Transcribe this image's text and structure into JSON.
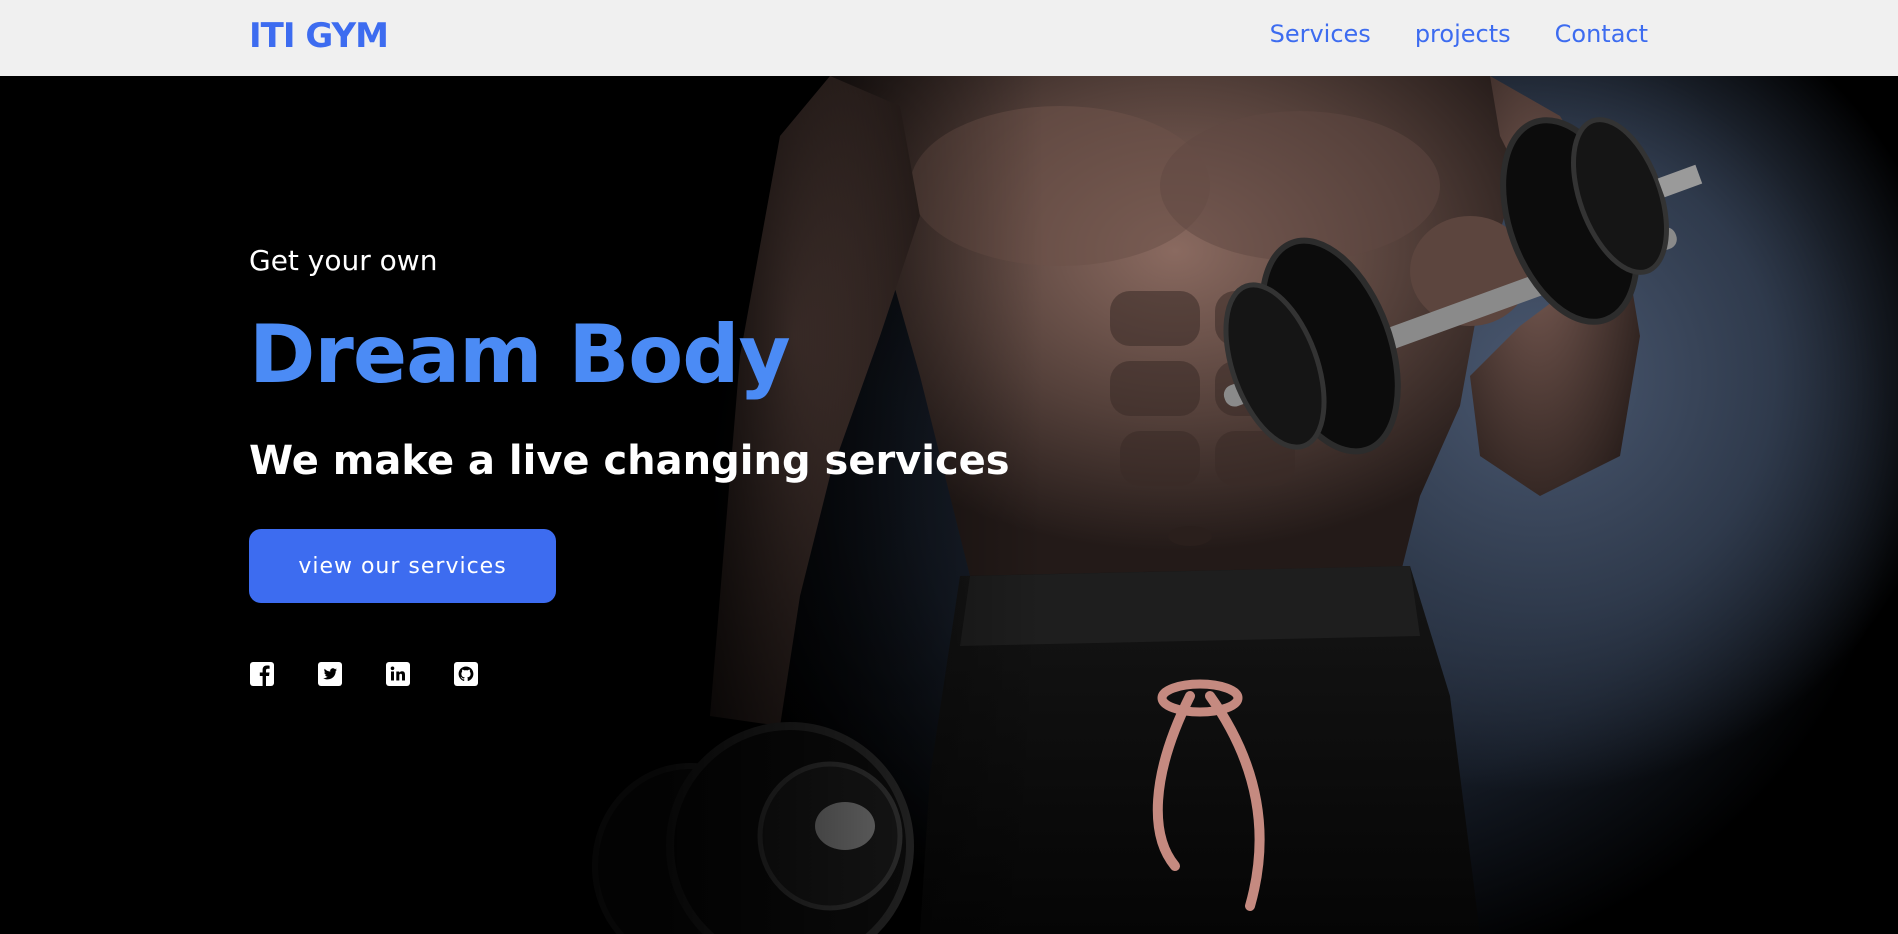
{
  "brand": "ITI GYM",
  "nav": {
    "items": [
      {
        "label": "Services"
      },
      {
        "label": "projects"
      },
      {
        "label": "Contact"
      }
    ]
  },
  "hero": {
    "eyebrow": "Get your own",
    "headline": "Dream Body",
    "tagline": "We make a live changing services",
    "cta_label": "view our services",
    "socials": [
      "facebook-icon",
      "twitter-icon",
      "linkedin-icon",
      "github-icon"
    ]
  },
  "colors": {
    "accent": "#3d6cf0",
    "headline": "#4b8bf5",
    "navbar_bg": "#f0f0f0",
    "hero_bg": "#000000"
  }
}
